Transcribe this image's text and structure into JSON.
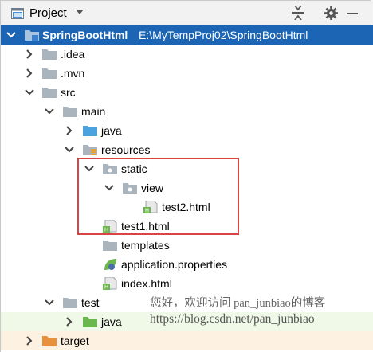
{
  "toolbar": {
    "title": "Project"
  },
  "tree": {
    "root": {
      "name": "SpringBootHtml",
      "path": "E:\\MyTempProj02\\SpringBootHtml"
    },
    "idea": ".idea",
    "mvn": ".mvn",
    "src": "src",
    "main": "main",
    "java": "java",
    "resources": "resources",
    "static": "static",
    "view": "view",
    "test2": "test2.html",
    "test1": "test1.html",
    "templates": "templates",
    "app_props": "application.properties",
    "index": "index.html",
    "test": "test",
    "test_java": "java",
    "target": "target"
  },
  "watermark": {
    "line1": "您好，欢迎访问 pan_junbiao的博客",
    "line2": "https://blog.csdn.net/pan_junbiao"
  },
  "colors": {
    "selection": "#1c64b4",
    "highlight_box": "#d94545",
    "folder": "#a9b4bd",
    "source_folder": "#4aa3df",
    "test_folder": "#6cb64e",
    "target_folder": "#e8913d"
  }
}
